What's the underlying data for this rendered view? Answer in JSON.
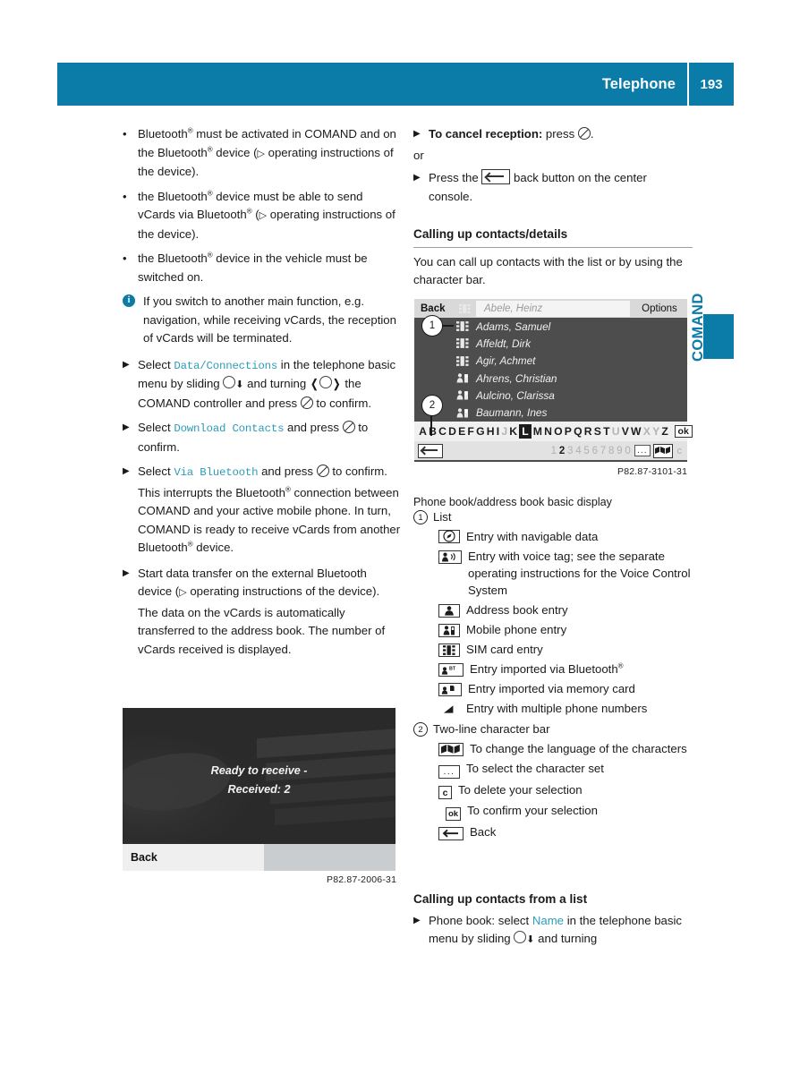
{
  "header": {
    "title": "Telephone",
    "page_number": "193"
  },
  "side_tab": {
    "label": "COMAND"
  },
  "left_column": {
    "bullets": [
      {
        "pre": "Bluetooth",
        "sup": "®",
        "post": " must be activated in COMAND and on the Bluetooth",
        "sup2": "®",
        "post2": " device (▷ operating instructions of the device)."
      },
      {
        "text": "the Bluetooth® device must be able to send vCards via Bluetooth® (▷ operating instructions of the device)."
      },
      {
        "text": "the Bluetooth® device in the vehicle must be switched on."
      }
    ],
    "bullet1_a": "Bluetooth",
    "bullet1_b": " must be activated in COMAND and on the Bluetooth",
    "bullet1_c": " device (",
    "bullet1_d": " operating instructions of the device).",
    "bullet2_a": "the Bluetooth",
    "bullet2_b": " device must be able to send vCards via Bluetooth",
    "bullet2_c": " (",
    "bullet2_d": " operating instructions of the device).",
    "bullet3_a": "the Bluetooth",
    "bullet3_b": " device in the vehicle must be switched on.",
    "note": "If you switch to another main function, e.g. navigation, while receiving vCards, the reception of vCards will be terminated.",
    "step1_a": "Select ",
    "step1_menu": "Data/Connections",
    "step1_b": " in the telephone basic menu by sliding ",
    "step1_c": " and turning ",
    "step1_d": " the COMAND controller and press ",
    "step1_e": " to confirm.",
    "step2_a": "Select ",
    "step2_menu": "Download Contacts",
    "step2_b": " and press ",
    "step2_c": " to confirm.",
    "step3_a": "Select ",
    "step3_menu": "Via Bluetooth",
    "step3_b": " and press ",
    "step3_c": " to confirm.",
    "step3_body_a": "This interrupts the Bluetooth",
    "step3_body_b": " connection between COMAND and your active mobile phone. In turn, COMAND is ready to receive vCards from another Bluetooth",
    "step3_body_c": " device.",
    "step4_a": "Start data transfer on the external Bluetooth device (",
    "step4_b": " operating instructions of the device).",
    "step4_body": "The data on the vCards is automatically transferred to the address book. The number of vCards received is displayed.",
    "screenshot": {
      "message_line1": "Ready to receive -",
      "message_line2": "Received: 2",
      "back_label": "Back",
      "caption": "P82.87-2006-31"
    }
  },
  "right_column": {
    "cancel_a": "To cancel reception:",
    "cancel_b": " press ",
    "cancel_c": ".",
    "or": "or",
    "press_back_a": "Press the ",
    "press_back_b": " back button on the center console.",
    "section_title": "Calling up contacts/details",
    "section_intro": "You can call up contacts with the list or by using the character bar.",
    "phonebook": {
      "back_label": "Back",
      "search_value": "Abele, Heinz",
      "options_label": "Options",
      "contacts": [
        {
          "name": "Adams, Samuel",
          "icon": "sim-card-icon"
        },
        {
          "name": "Affeldt, Dirk",
          "icon": "sim-card-icon"
        },
        {
          "name": "Agir, Achmet",
          "icon": "sim-card-icon"
        },
        {
          "name": "Ahrens, Christian",
          "icon": "mobile-phone-entry-icon"
        },
        {
          "name": "Aulcino, Clarissa",
          "icon": "mobile-phone-entry-icon"
        },
        {
          "name": "Baumann, Ines",
          "icon": "mobile-phone-entry-icon"
        }
      ],
      "alphabet": [
        {
          "ch": "A",
          "state": "on"
        },
        {
          "ch": "B",
          "state": "on"
        },
        {
          "ch": "C",
          "state": "on"
        },
        {
          "ch": "D",
          "state": "on"
        },
        {
          "ch": "E",
          "state": "on"
        },
        {
          "ch": "F",
          "state": "on"
        },
        {
          "ch": "G",
          "state": "on"
        },
        {
          "ch": "H",
          "state": "on"
        },
        {
          "ch": "I",
          "state": "on"
        },
        {
          "ch": "J",
          "state": "dim"
        },
        {
          "ch": "K",
          "state": "on"
        },
        {
          "ch": "L",
          "state": "selected"
        },
        {
          "ch": "M",
          "state": "on"
        },
        {
          "ch": "N",
          "state": "on"
        },
        {
          "ch": "O",
          "state": "on"
        },
        {
          "ch": "P",
          "state": "on"
        },
        {
          "ch": "Q",
          "state": "on"
        },
        {
          "ch": "R",
          "state": "on"
        },
        {
          "ch": "S",
          "state": "on"
        },
        {
          "ch": "T",
          "state": "on"
        },
        {
          "ch": "U",
          "state": "dim"
        },
        {
          "ch": "V",
          "state": "on"
        },
        {
          "ch": "W",
          "state": "on"
        },
        {
          "ch": "X",
          "state": "dim"
        },
        {
          "ch": "Y",
          "state": "dim"
        },
        {
          "ch": "Z",
          "state": "on"
        },
        {
          "ch": "_",
          "state": "dim"
        }
      ],
      "ok_label": "ok",
      "digits": [
        {
          "ch": "1",
          "state": "dim"
        },
        {
          "ch": "2",
          "state": "on"
        },
        {
          "ch": "3",
          "state": "dim"
        },
        {
          "ch": "4",
          "state": "dim"
        },
        {
          "ch": "5",
          "state": "dim"
        },
        {
          "ch": "6",
          "state": "dim"
        },
        {
          "ch": "7",
          "state": "dim"
        },
        {
          "ch": "8",
          "state": "dim"
        },
        {
          "ch": "9",
          "state": "dim"
        },
        {
          "ch": "0",
          "state": "dim"
        }
      ],
      "dots_label": "...",
      "c_label": "c",
      "caption": "P82.87-3101-31"
    },
    "legend_caption": "Phone book/address book basic display",
    "legend1_num": "1",
    "legend1_label": "List",
    "legend1_items": [
      {
        "icon": "navigable-data-icon",
        "text": "Entry with navigable data"
      },
      {
        "icon": "voice-tag-icon",
        "text": "Entry with voice tag; see the separate operating instructions for the Voice Control System"
      },
      {
        "icon": "address-book-entry-icon",
        "text": "Address book entry"
      },
      {
        "icon": "mobile-phone-entry-icon",
        "text": "Mobile phone entry"
      },
      {
        "icon": "sim-card-icon",
        "text": "SIM card entry"
      },
      {
        "icon": "bluetooth-import-icon",
        "text": "Entry imported via Bluetooth®"
      },
      {
        "icon": "memory-card-import-icon",
        "text": "Entry imported via memory card"
      },
      {
        "icon": "multiple-numbers-icon",
        "text": "Entry with multiple phone numbers"
      }
    ],
    "legend2_num": "2",
    "legend2_label": "Two-line character bar",
    "legend2_items": [
      {
        "icon": "language-flag-icon",
        "text": "To change the language of the characters"
      },
      {
        "icon": "character-set-icon",
        "text": "To select the character set"
      },
      {
        "icon": "clear-icon",
        "text": "To delete your selection"
      },
      {
        "icon": "ok-icon",
        "text": "To confirm your selection"
      },
      {
        "icon": "back-icon",
        "text": "Back"
      }
    ],
    "final_section_title": "Calling up contacts from a list",
    "final_step_a": "Phone book: select ",
    "final_step_menu": "Name",
    "final_step_b": " in the telephone basic menu by sliding ",
    "final_step_c": " and turning"
  }
}
